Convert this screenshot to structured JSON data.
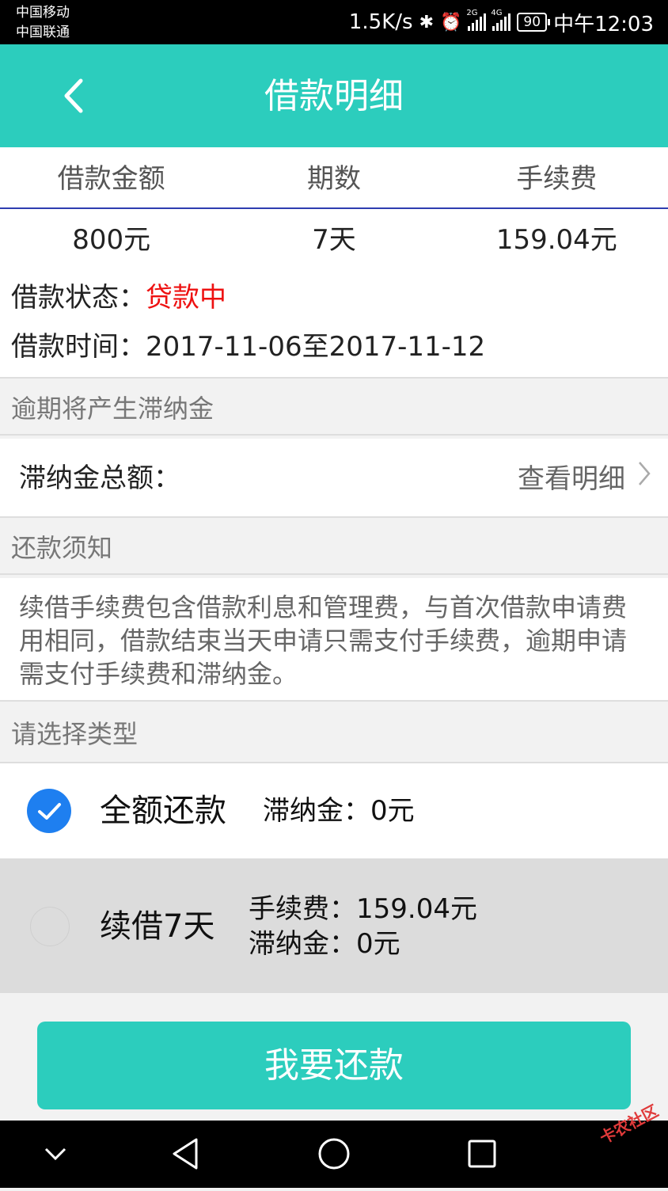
{
  "status_bar": {
    "carrier_1": "中国移动",
    "carrier_2": "中国联通",
    "speed": "1.5K/s",
    "network_1": "2G",
    "network_2": "4G",
    "battery": "90",
    "time": "中午12:03"
  },
  "header": {
    "title": "借款明细"
  },
  "summary": {
    "columns": [
      "借款金额",
      "期数",
      "手续费"
    ],
    "values": [
      "800元",
      "7天",
      "159.04元"
    ],
    "status_label": "借款状态：",
    "status_value": "贷款中",
    "time_label": "借款时间：",
    "time_value": "2017-11-06至2017-11-12"
  },
  "overdue": {
    "section_label": "逾期将产生滞纳金",
    "total_label": "滞纳金总额：",
    "detail_link": "查看明细"
  },
  "notice": {
    "section_label": "还款须知",
    "text": "续借手续费包含借款利息和管理费，与首次借款申请费用相同，借款结束当天申请只需支付手续费，逾期申请需支付手续费和滞纳金。"
  },
  "type_select": {
    "section_label": "请选择类型",
    "options": [
      {
        "name": "全额还款",
        "late_fee": "滞纳金：0元",
        "selected": true
      },
      {
        "name": "续借7天",
        "fee": "手续费：159.04元",
        "late_fee": "滞纳金：0元",
        "selected": false
      }
    ]
  },
  "actions": {
    "pay_button": "我要还款"
  },
  "watermark": "卡农社区",
  "colors": {
    "accent": "#2ccdbd",
    "status_red": "#ee1111",
    "radio_blue": "#1e7ff0"
  },
  "icons": [
    "back-arrow-icon",
    "chevron-right-icon",
    "checkmark-icon",
    "nav-collapse-icon",
    "nav-back-icon",
    "nav-home-icon",
    "nav-recents-icon"
  ]
}
